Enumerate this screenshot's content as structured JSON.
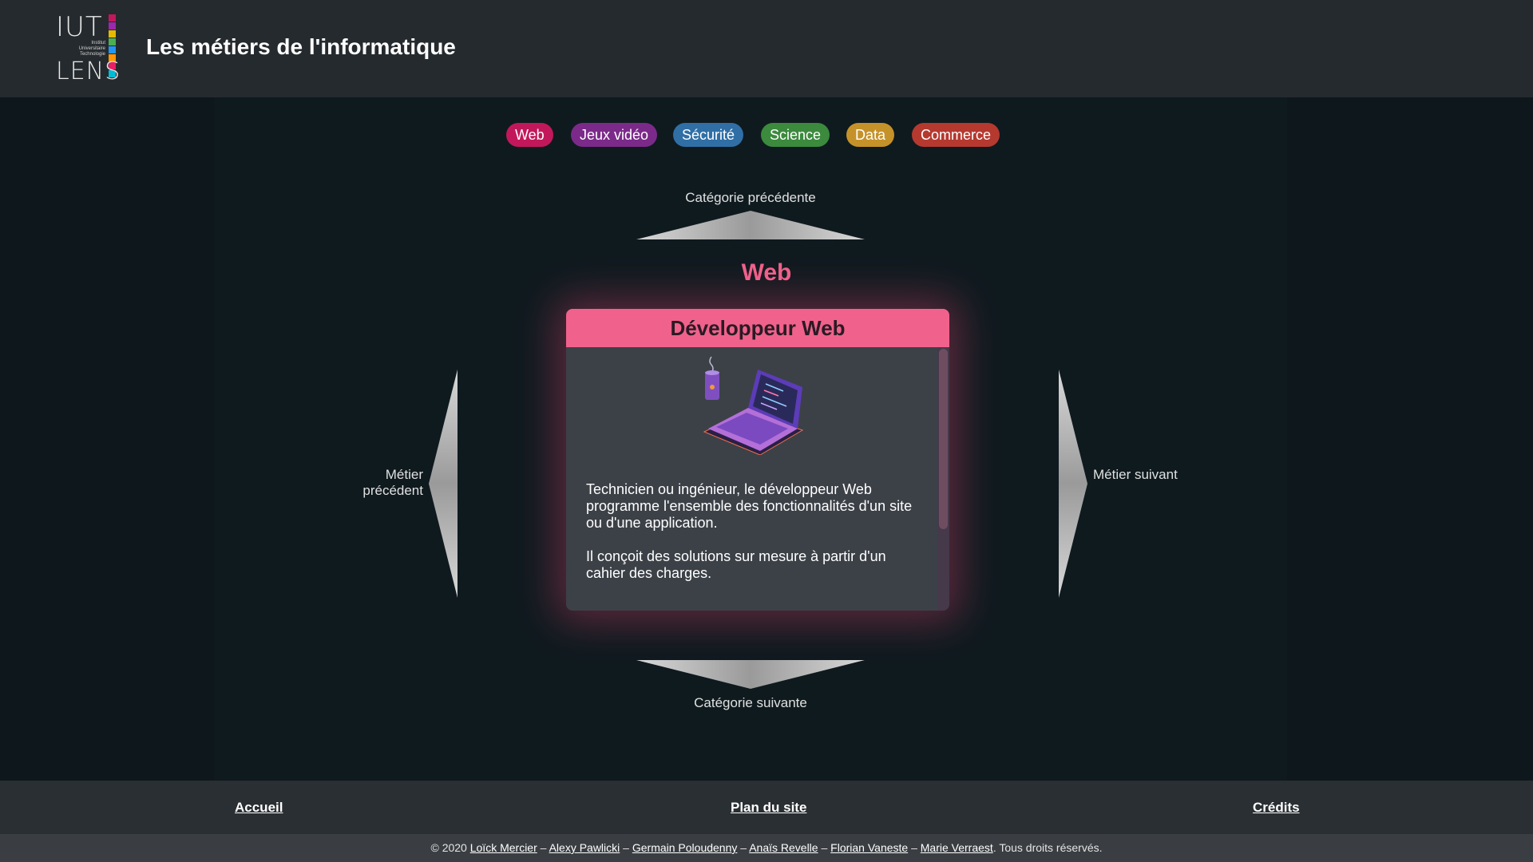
{
  "header": {
    "logo": {
      "top_text": "IUT",
      "bottom_text": "LENS",
      "subtitle": "Institut Universitaire Technologie",
      "bar_colors": [
        "#c2185b",
        "#9c27b0",
        "#e6b800",
        "#4caf50",
        "#2196f3",
        "#ff9800",
        "#e91e63",
        "#00bcd4"
      ]
    },
    "title": "Les métiers de l'informatique"
  },
  "tags": [
    {
      "label": "Web",
      "color": "#c2185b"
    },
    {
      "label": "Jeux vidéo",
      "color": "#7b2a8a"
    },
    {
      "label": "Sécurité",
      "color": "#2f6fa6"
    },
    {
      "label": "Science",
      "color": "#3b8a3d"
    },
    {
      "label": "Data",
      "color": "#c5922a"
    },
    {
      "label": "Commerce",
      "color": "#b5392f"
    }
  ],
  "navigation": {
    "prev_category": "Catégorie précédente",
    "next_category": "Catégorie suivante",
    "prev_job": "Métier précédent",
    "next_job": "Métier suivant"
  },
  "category": {
    "name": "Web",
    "color": "#f0628b"
  },
  "card": {
    "title": "Développeur Web",
    "paragraphs": [
      "Technicien ou ingénieur, le développeur Web programme l'ensemble des fonctionnalités d'un site ou d'une application.",
      "Il conçoit des solutions sur mesure à partir d'un cahier des charges."
    ]
  },
  "footer": {
    "links": {
      "home": "Accueil",
      "sitemap": "Plan du site",
      "credits": "Crédits"
    },
    "copyright_prefix": "© 2020",
    "authors": [
      "Loïck Mercier",
      "Alexy Pawlicki",
      "Germain Poloudenny",
      "Anaïs Revelle",
      "Florian Vaneste",
      "Marie Verraest"
    ],
    "separator": "–",
    "copyright_suffix": ". Tous droits réservés."
  }
}
